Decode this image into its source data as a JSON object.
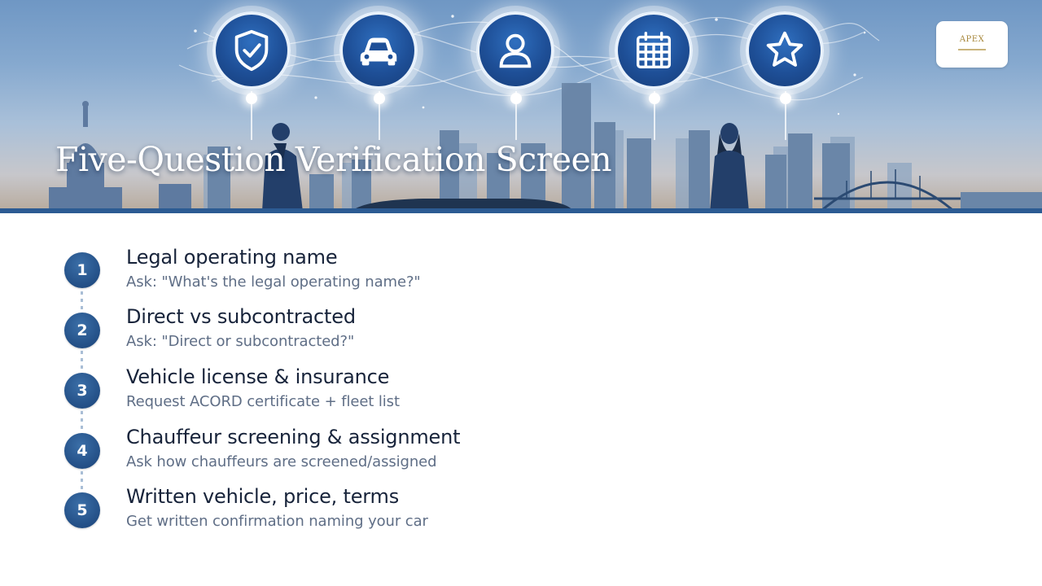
{
  "header": {
    "title": "Five-Question Verification Screen",
    "logo_text": "APEX",
    "icons": [
      {
        "name": "shield-check-icon"
      },
      {
        "name": "car-icon"
      },
      {
        "name": "person-icon"
      },
      {
        "name": "calendar-icon"
      },
      {
        "name": "star-icon"
      }
    ]
  },
  "steps": [
    {
      "number": "1",
      "title": "Legal operating name",
      "desc": "Ask: \"What's the legal operating name?\""
    },
    {
      "number": "2",
      "title": "Direct vs subcontracted",
      "desc": "Ask: \"Direct or subcontracted?\""
    },
    {
      "number": "3",
      "title": "Vehicle license & insurance",
      "desc": "Request ACORD certificate + fleet list"
    },
    {
      "number": "4",
      "title": "Chauffeur screening & assignment",
      "desc": "Ask how chauffeurs are screened/assigned"
    },
    {
      "number": "5",
      "title": "Written vehicle, price, terms",
      "desc": "Get written confirmation naming your car"
    }
  ],
  "colors": {
    "accent": "#234f86",
    "title_text": "#17233a",
    "desc_text": "#5f6e86",
    "hero_stripe": "#2c5b93"
  }
}
